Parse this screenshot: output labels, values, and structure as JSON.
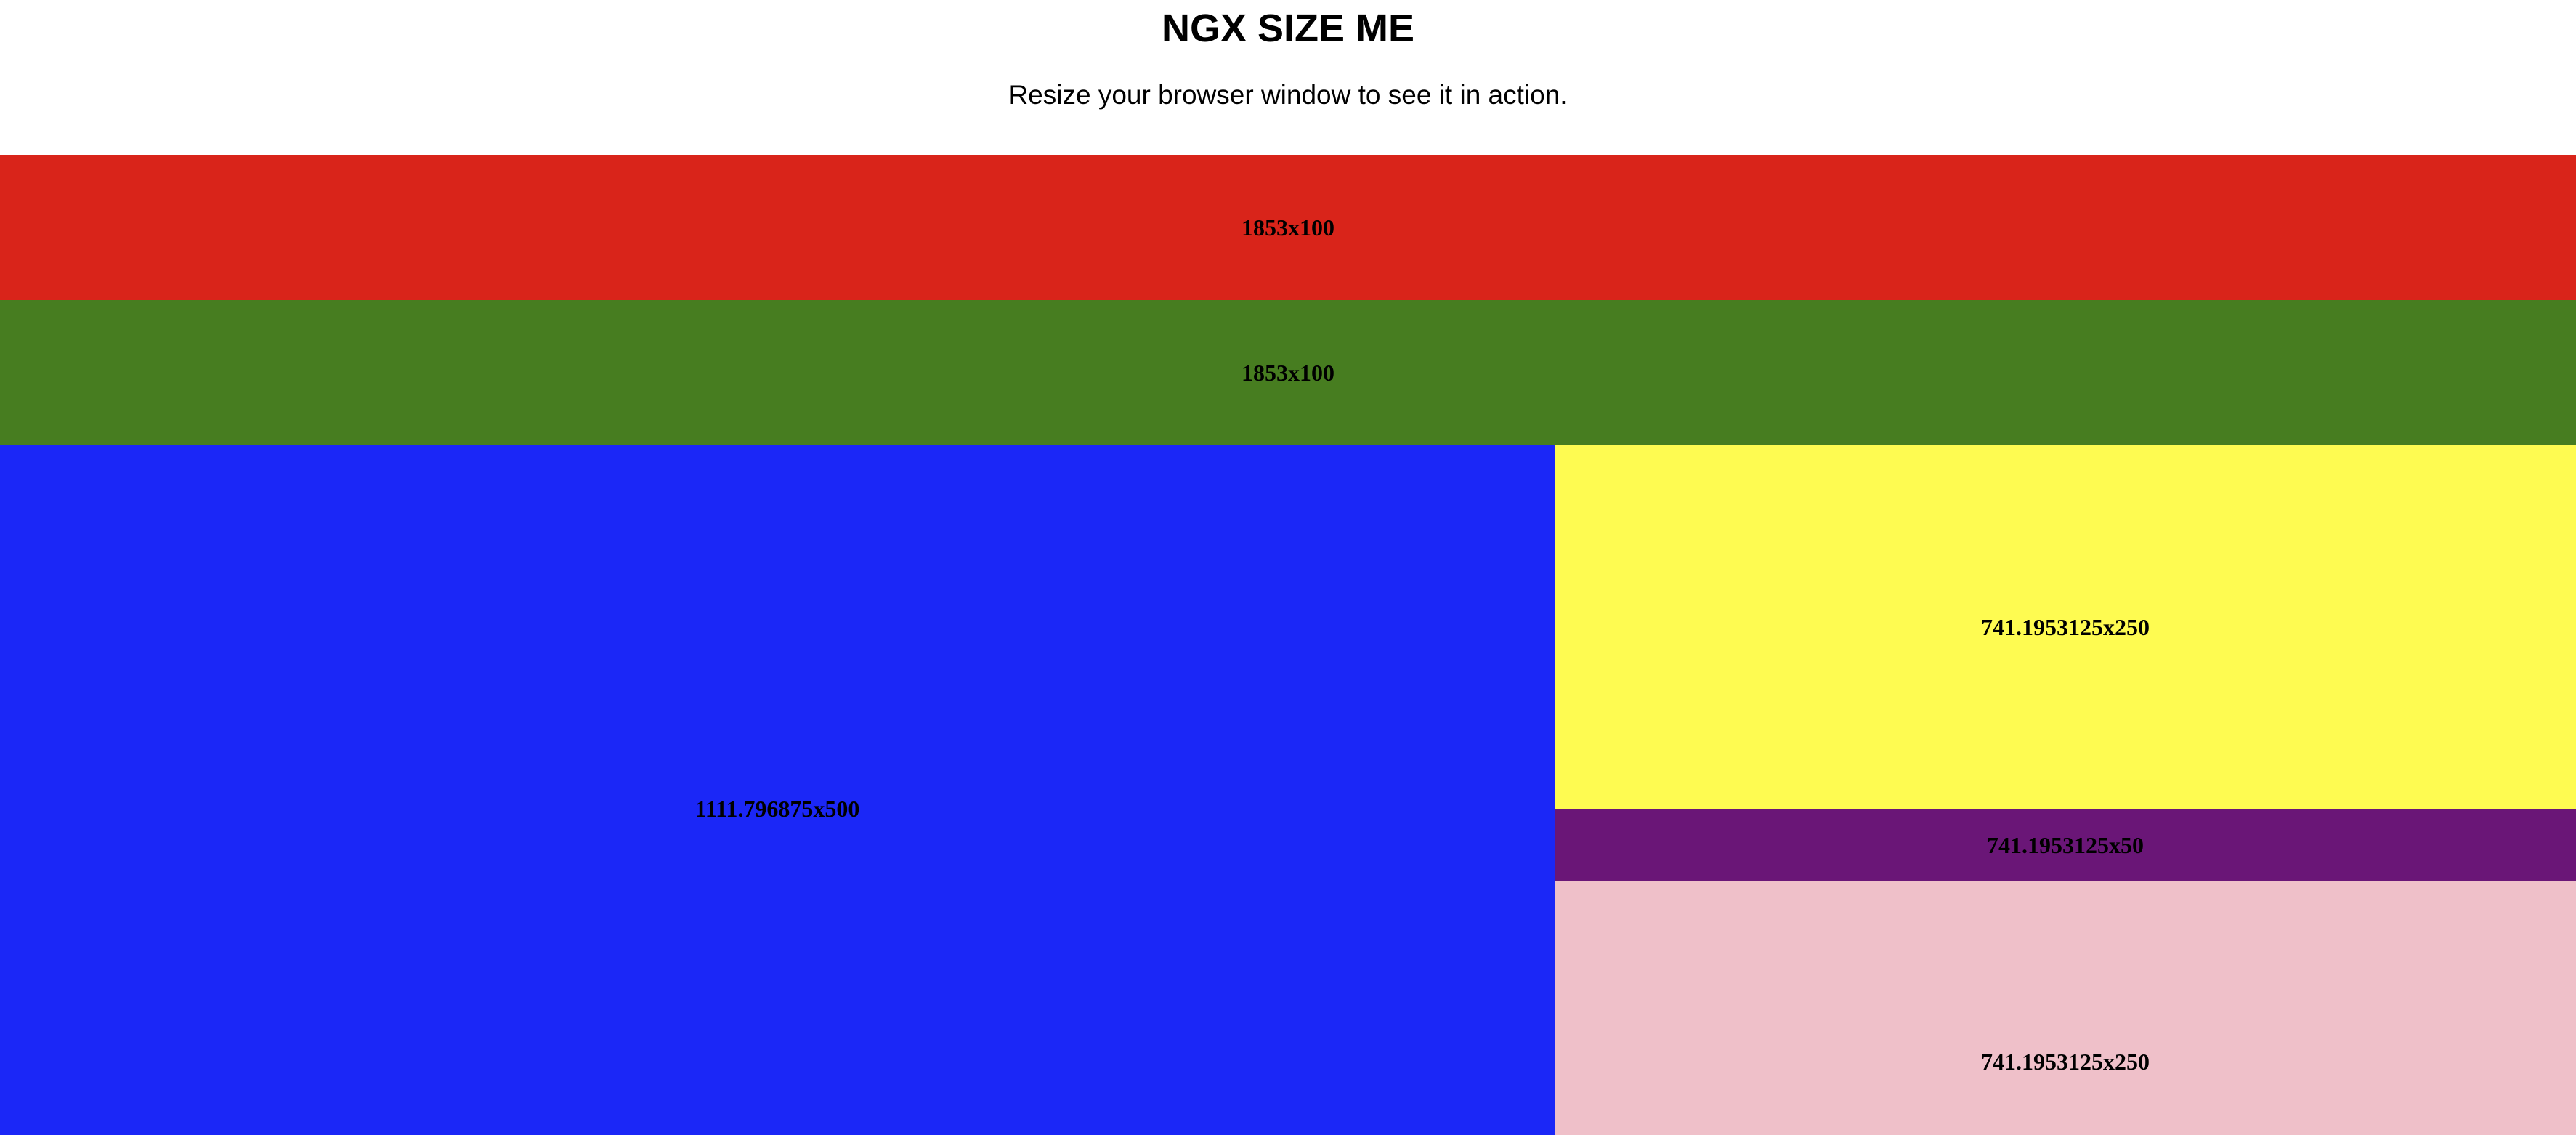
{
  "header": {
    "title": "NGX SIZE ME",
    "subtitle": "Resize your browser window to see it in action."
  },
  "boxes": {
    "red": {
      "label": "1853x100",
      "color": "#d9241a"
    },
    "green": {
      "label": "1853x100",
      "color": "#477d20"
    },
    "blue": {
      "label": "1111.796875x500",
      "color": "#1b27f7"
    },
    "yellow": {
      "label": "741.1953125x250",
      "color": "#fefb51"
    },
    "purple": {
      "label": "741.1953125x50",
      "color": "#6a1677"
    },
    "pink": {
      "label": "741.1953125x250",
      "color": "#efc0c9"
    }
  }
}
